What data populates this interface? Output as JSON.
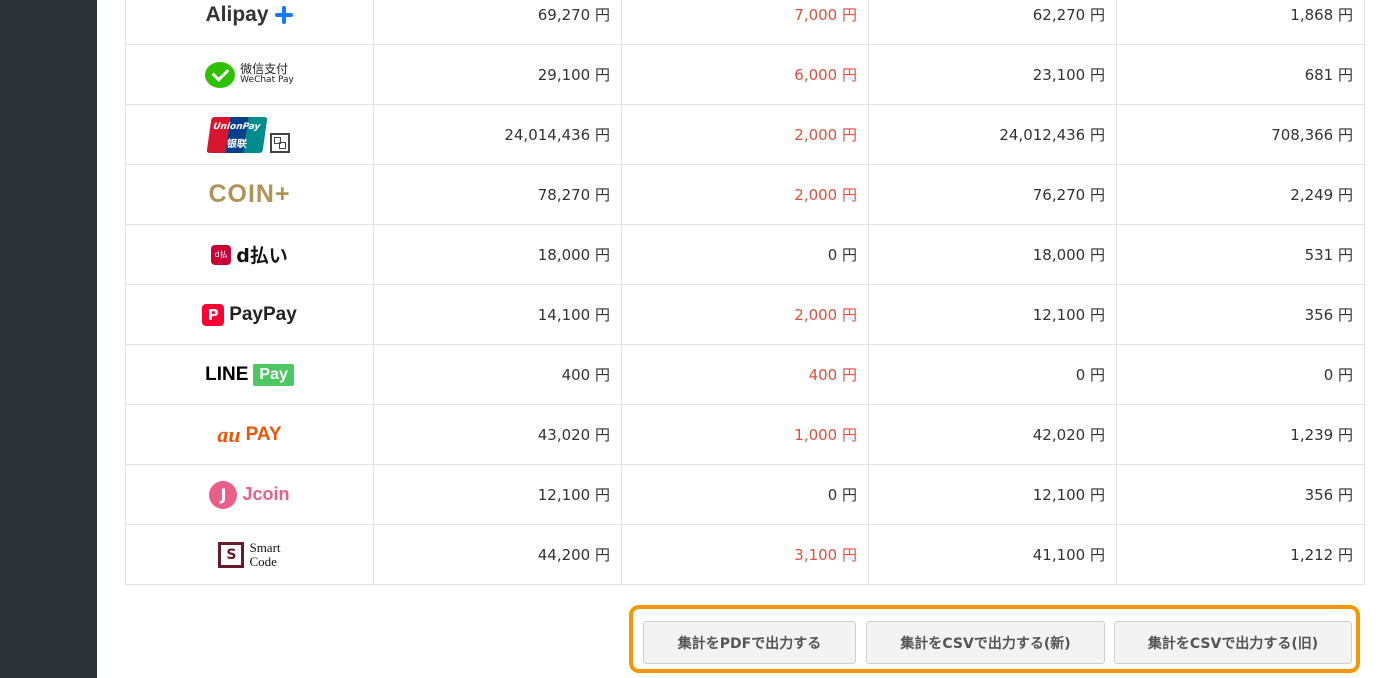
{
  "rows": [
    {
      "brand": "Alipay",
      "total": "69,270 円",
      "refund": "7,000 円",
      "net": "62,270 円",
      "fee": "1,868 円"
    },
    {
      "brand": "WeChat Pay",
      "brand_cn": "微信支付",
      "total": "29,100 円",
      "refund": "6,000 円",
      "net": "23,100 円",
      "fee": "681 円"
    },
    {
      "brand": "UnionPay",
      "brand_cn": "银联",
      "total": "24,014,436 円",
      "refund": "2,000 円",
      "net": "24,012,436 円",
      "fee": "708,366 円"
    },
    {
      "brand": "COIN+",
      "total": "78,270 円",
      "refund": "2,000 円",
      "net": "76,270 円",
      "fee": "2,249 円"
    },
    {
      "brand": "d払い",
      "icon_text": "d払い",
      "total": "18,000 円",
      "refund": "0 円",
      "net": "18,000 円",
      "fee": "531 円"
    },
    {
      "brand": "PayPay",
      "total": "14,100 円",
      "refund": "2,000 円",
      "net": "12,100 円",
      "fee": "356 円"
    },
    {
      "brand": "LINE",
      "brand_pay": "Pay",
      "total": "400 円",
      "refund": "400 円",
      "net": "0 円",
      "fee": "0 円"
    },
    {
      "brand": "au",
      "brand_pay": "PAY",
      "total": "43,020 円",
      "refund": "1,000 円",
      "net": "42,020 円",
      "fee": "1,239 円"
    },
    {
      "brand": "Jcoin",
      "total": "12,100 円",
      "refund": "0 円",
      "net": "12,100 円",
      "fee": "356 円"
    },
    {
      "brand": "Smart",
      "brand_line2": "Code",
      "total": "44,200 円",
      "refund": "3,100 円",
      "net": "41,100 円",
      "fee": "1,212 円"
    }
  ],
  "export": {
    "pdf_label": "集計をPDFで出力する",
    "csv_new_label": "集計をCSVで出力する(新)",
    "csv_old_label": "集計をCSVで出力する(旧)"
  },
  "colors": {
    "sidebar": "#2b3238",
    "refund_red": "#e74c3c",
    "highlight_border": "#f39800"
  }
}
